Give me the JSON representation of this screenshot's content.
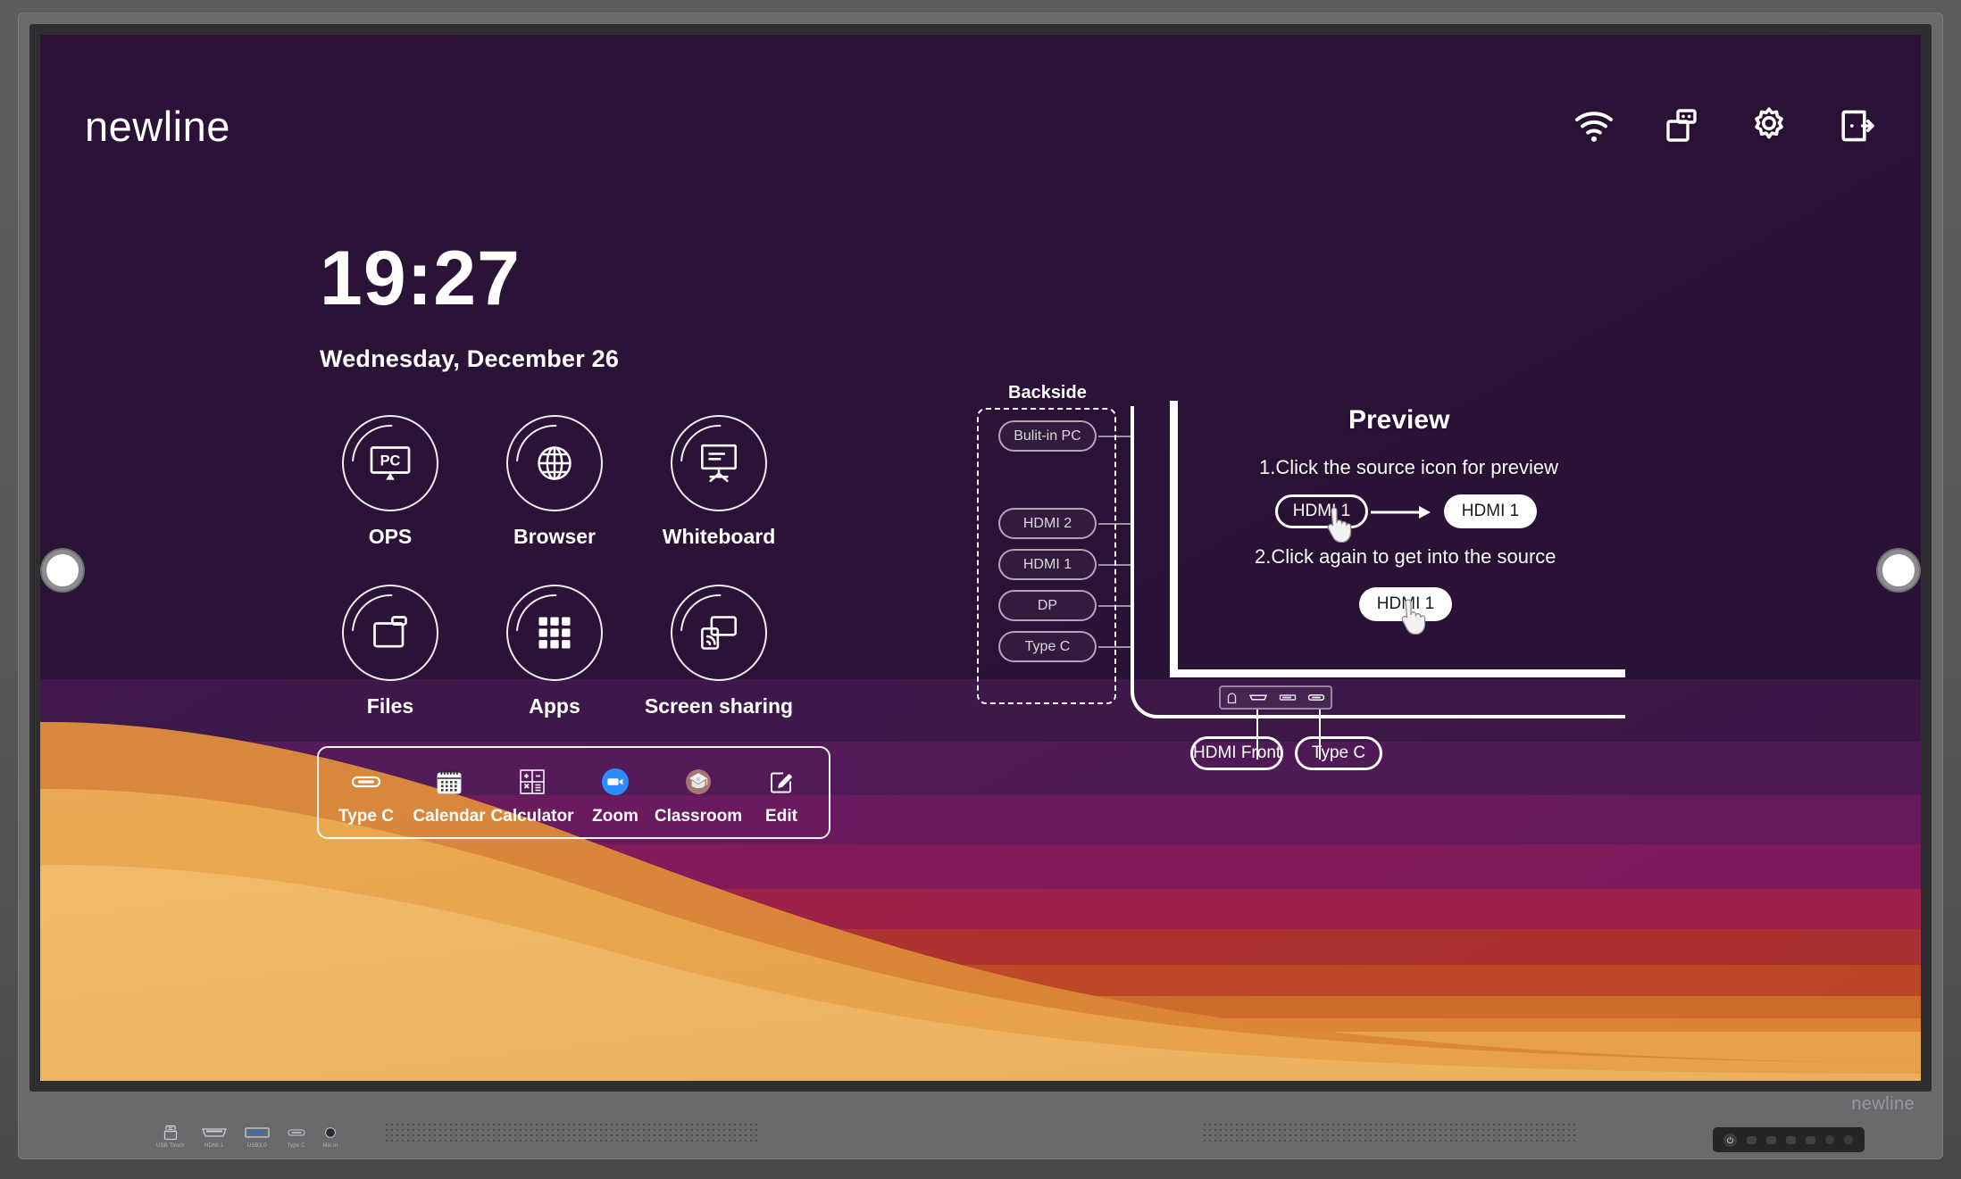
{
  "brand": {
    "logo": "newline",
    "bezel_logo": "newline"
  },
  "status_bar": {
    "icons": [
      {
        "name": "wifi-icon",
        "label": "Wi-Fi"
      },
      {
        "name": "usb-drive-icon",
        "label": "USB"
      },
      {
        "name": "gear-icon",
        "label": "Settings"
      },
      {
        "name": "exit-icon",
        "label": "Exit"
      }
    ]
  },
  "clock": {
    "time": "19:27",
    "date": "Wednesday, December 26"
  },
  "apps": [
    {
      "label": "OPS",
      "icon": "pc-monitor-icon"
    },
    {
      "label": "Browser",
      "icon": "globe-icon"
    },
    {
      "label": "Whiteboard",
      "icon": "whiteboard-icon"
    },
    {
      "label": "Files",
      "icon": "folder-icon"
    },
    {
      "label": "Apps",
      "icon": "grid-apps-icon"
    },
    {
      "label": "Screen sharing",
      "icon": "cast-icon"
    }
  ],
  "dock": [
    {
      "label": "Type C",
      "icon": "usb-c-icon"
    },
    {
      "label": "Calendar",
      "icon": "calendar-icon"
    },
    {
      "label": "Calculator",
      "icon": "calculator-icon"
    },
    {
      "label": "Zoom",
      "icon": "zoom-camera-icon"
    },
    {
      "label": "Classroom",
      "icon": "google-classroom-icon"
    },
    {
      "label": "Edit",
      "icon": "pencil-square-icon"
    }
  ],
  "backside": {
    "title": "Backside",
    "sources": [
      {
        "label": "Bulit-in PC"
      },
      {
        "label": "HDMI 2"
      },
      {
        "label": "HDMI 1"
      },
      {
        "label": "DP"
      },
      {
        "label": "Type C"
      }
    ]
  },
  "preview": {
    "title": "Preview",
    "step1_text": "1.Click the source icon for preview",
    "step1_source_pill": "HDMI 1",
    "step1_result_pill": "HDMI 1",
    "step2_text": "2.Click again to get into the source",
    "step2_pill": "HDMI 1"
  },
  "front_panel": {
    "ports": [
      "power-port-icon",
      "hdmi-port-icon",
      "usb-a-port-icon",
      "usb-c-port-icon"
    ],
    "hdmi_label": "HDMI Front",
    "typec_label": "Type C"
  },
  "hardware_ports": [
    {
      "label": "USB Touch",
      "icon": "usb-b-icon"
    },
    {
      "label": "HDMI 1",
      "icon": "hdmi-icon"
    },
    {
      "label": "USB3.0",
      "icon": "usb-a-icon"
    },
    {
      "label": "Type C",
      "icon": "usb-c-icon"
    },
    {
      "label": "Mic in",
      "icon": "mic-jack-icon"
    }
  ],
  "colors": {
    "wallpaper_dark": "#2a1236",
    "wallpaper_purple": "#5b2063",
    "wallpaper_magenta": "#9c1d5e",
    "wallpaper_crimson": "#c0392b",
    "wallpaper_orange": "#e07b34",
    "wallpaper_amber": "#efb661",
    "accent_white": "#ffffff",
    "zoom_blue": "#2d8cff",
    "bezel_gray": "#6a6a6c"
  }
}
